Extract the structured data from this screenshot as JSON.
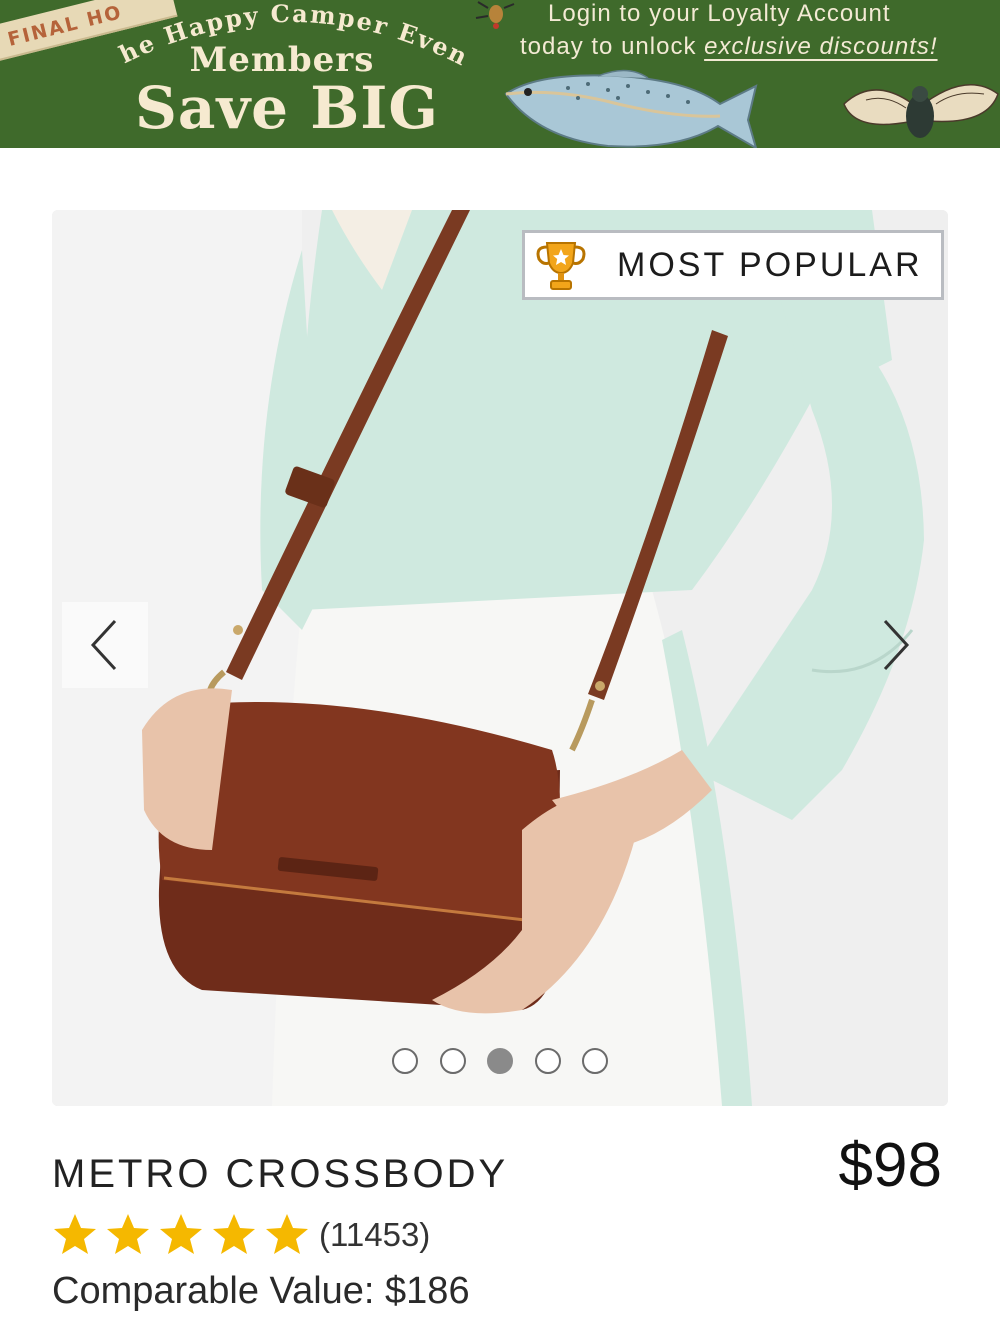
{
  "banner": {
    "ribbon_text": "FINAL HO",
    "arc_text": "The Happy Camper Event",
    "members": "Members",
    "save_big": "Save BIG",
    "login_line1": "Login to your Loyalty Account",
    "login_line2_prefix": "today to unlock ",
    "login_line2_link": "exclusive discounts!",
    "colors": {
      "background": "#3f6a2b",
      "text": "#f6ead0",
      "ribbon": "#e7d9b6"
    }
  },
  "gallery": {
    "badge_text": "MOST POPULAR",
    "badge_icon": "trophy-icon",
    "prev_icon": "chevron-left-icon",
    "next_icon": "chevron-right-icon",
    "slide_count": 5,
    "active_slide": 3
  },
  "product": {
    "title": "METRO CROSSBODY",
    "price": "$98",
    "rating": 5,
    "review_count": "(11453)",
    "comparable_value": "Comparable Value: $186",
    "star_color": "#f5b800"
  }
}
